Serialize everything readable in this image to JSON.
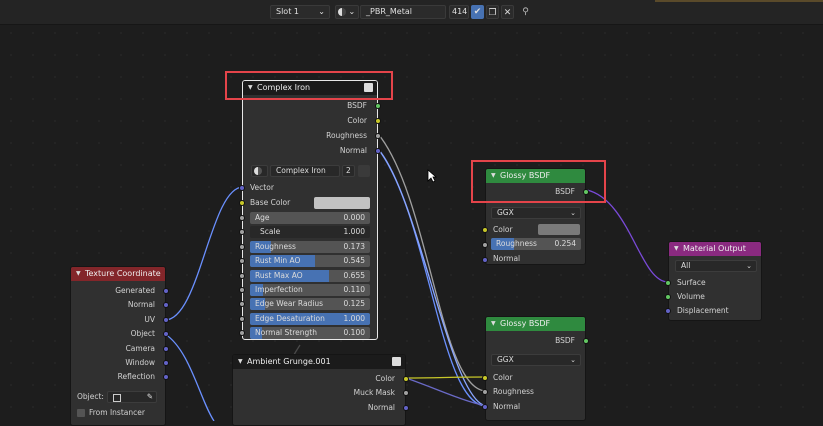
{
  "header": {
    "slot": "Slot 1",
    "material_name": "_PBR_Metal",
    "user_count": "414",
    "colors": {
      "shield": "#4772b3"
    }
  },
  "complex_iron": {
    "title": "Complex Iron",
    "outputs": [
      "BSDF",
      "Color",
      "Roughness",
      "Normal"
    ],
    "group_name": "Complex Iron",
    "group_users": "2",
    "vector_label": "Vector",
    "base_color_label": "Base Color",
    "base_color": "#c2c2c2",
    "params": [
      {
        "label": "Age",
        "value": "0.000",
        "fill": 0.0
      },
      {
        "label": "Scale",
        "value": "1.000",
        "fill": 0.0
      },
      {
        "label": "Roughness",
        "value": "0.173",
        "fill": 0.173
      },
      {
        "label": "Rust Min AO",
        "value": "0.545",
        "fill": 0.545
      },
      {
        "label": "Rust Max AO",
        "value": "0.655",
        "fill": 0.655
      },
      {
        "label": "Imperfection",
        "value": "0.110",
        "fill": 0.11
      },
      {
        "label": "Edge Wear Radius",
        "value": "0.125",
        "fill": 0.125
      },
      {
        "label": "Edge Desaturation",
        "value": "1.000",
        "fill": 1.0
      },
      {
        "label": "Normal Strength",
        "value": "0.100",
        "fill": 0.1
      }
    ]
  },
  "texture_coordinate": {
    "title": "Texture Coordinate",
    "outputs": [
      "Generated",
      "Normal",
      "UV",
      "Object",
      "Camera",
      "Window",
      "Reflection"
    ],
    "object_label": "Object:",
    "from_instancer": "From Instancer"
  },
  "ambient_grunge": {
    "title": "Ambient Grunge.001",
    "outputs": [
      "Color",
      "Muck Mask",
      "Normal"
    ]
  },
  "glossy1": {
    "title": "Glossy BSDF",
    "output": "BSDF",
    "distribution": "GGX",
    "color_label": "Color",
    "color": "#7a7a7a",
    "roughness_label": "Roughness",
    "roughness_value": "0.254",
    "roughness_fill": 0.254,
    "normal_label": "Normal"
  },
  "glossy2": {
    "title": "Glossy BSDF",
    "output": "BSDF",
    "distribution": "GGX",
    "inputs": [
      "Color",
      "Roughness",
      "Normal"
    ]
  },
  "material_output": {
    "title": "Material Output",
    "target": "All",
    "inputs": [
      "Surface",
      "Volume",
      "Displacement"
    ]
  },
  "colors": {
    "texture_header": "#83262a",
    "shader_header": "#2f8a3f",
    "output_header": "#8a2a80",
    "group_header": "#1b1b1b",
    "highlight": "#e4444a",
    "link_blue": "#6a90ff",
    "link_purple": "#7a4ad8",
    "link_yellow": "#c7c729"
  }
}
